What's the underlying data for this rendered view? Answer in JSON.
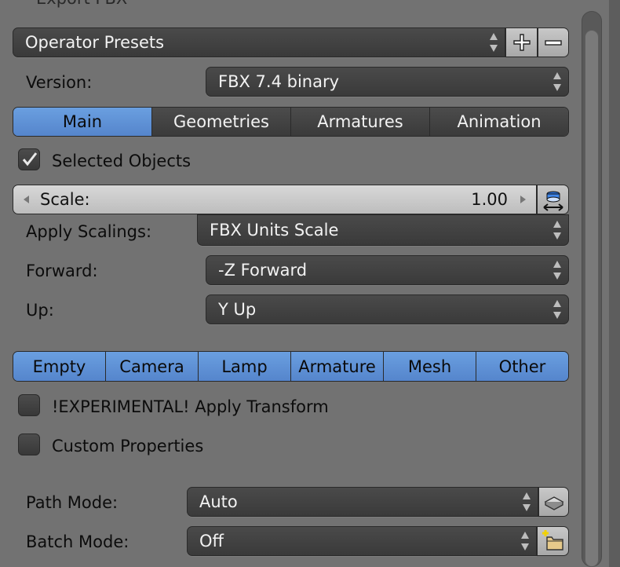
{
  "panel": {
    "title": "Export FBX"
  },
  "presets": {
    "label": "Operator Presets",
    "add_icon": "plus-icon",
    "remove_icon": "minus-icon"
  },
  "version": {
    "label": "Version:",
    "value": "FBX 7.4 binary"
  },
  "tabs": [
    {
      "label": "Main",
      "active": true
    },
    {
      "label": "Geometries",
      "active": false
    },
    {
      "label": "Armatures",
      "active": false
    },
    {
      "label": "Animation",
      "active": false
    }
  ],
  "selected_objects": {
    "label": "Selected Objects",
    "checked": true
  },
  "scale": {
    "label": "Scale:",
    "value": "1.00",
    "icon": "scale-apply-icon"
  },
  "apply_scalings": {
    "label": "Apply Scalings:",
    "value": "FBX Units Scale"
  },
  "forward": {
    "label": "Forward:",
    "value": "-Z Forward"
  },
  "up": {
    "label": "Up:",
    "value": "Y Up"
  },
  "object_types": [
    "Empty",
    "Camera",
    "Lamp",
    "Armature",
    "Mesh",
    "Other"
  ],
  "experimental": {
    "label": "!EXPERIMENTAL! Apply Transform",
    "checked": false
  },
  "custom_props": {
    "label": "Custom Properties",
    "checked": false
  },
  "path_mode": {
    "label": "Path Mode:",
    "value": "Auto",
    "icon": "embed-textures-icon"
  },
  "batch_mode": {
    "label": "Batch Mode:",
    "value": "Off",
    "icon": "new-folder-icon"
  },
  "colors": {
    "accent": "#5f92d8",
    "panel_bg": "#727272",
    "widget_bg": "#3e3e3e"
  }
}
